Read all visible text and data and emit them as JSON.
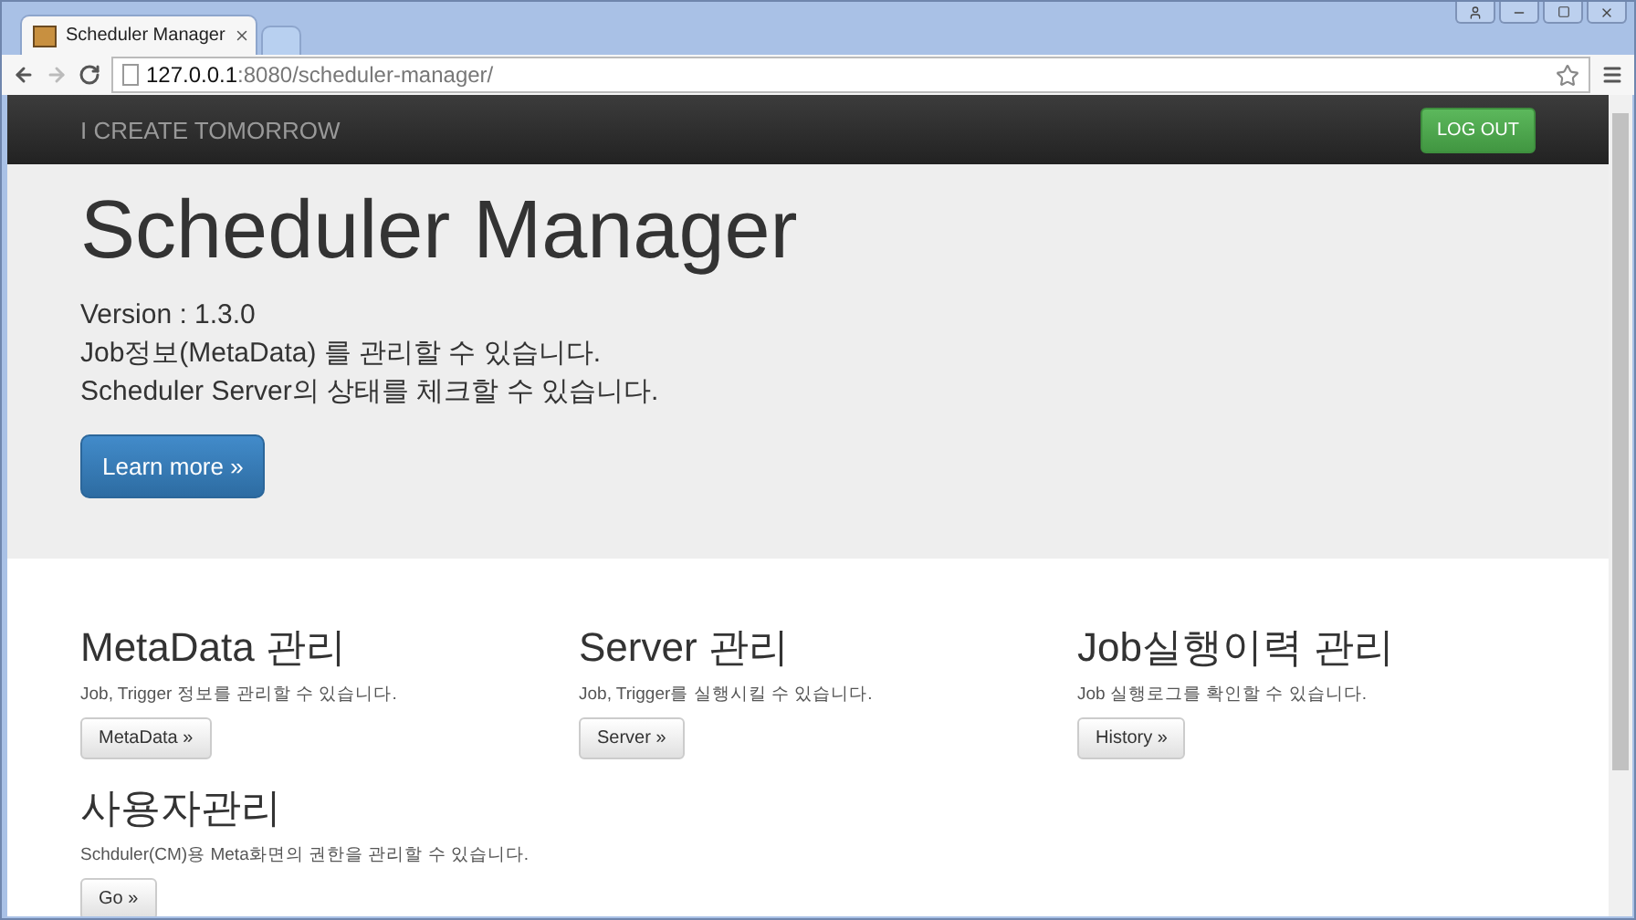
{
  "browser": {
    "tabs": [
      {
        "title": "Scheduler Manager",
        "selected": true
      },
      {
        "selected": false
      }
    ],
    "url": {
      "host": "127.0.0.1",
      "path": ":8080/scheduler-manager/"
    }
  },
  "navbar": {
    "brand": "I CREATE TOMORROW",
    "button": "LOG OUT"
  },
  "jumbotron": {
    "title": "Scheduler Manager",
    "lines": [
      "Version : 1.3.0",
      "Job정보(MetaData) 를 관리할 수 있습니다.",
      "Scheduler Server의 상태를 체크할 수 있습니다."
    ],
    "button": "Learn more »"
  },
  "sections": [
    {
      "heading": "MetaData 관리",
      "text": "Job, Trigger 정보를 관리할 수 있습니다.",
      "button": "MetaData »"
    },
    {
      "heading": "Server 관리",
      "text": "Job, Trigger를 실행시킬 수 있습니다.",
      "button": "Server »"
    },
    {
      "heading": "Job실행이력 관리",
      "text": "Job 실행로그를 확인할 수 있습니다.",
      "button": "History »"
    },
    {
      "heading": "사용자관리",
      "text": "Schduler(CM)용 Meta화면의 권한을 관리할 수 있습니다.",
      "button": "Go »"
    }
  ]
}
